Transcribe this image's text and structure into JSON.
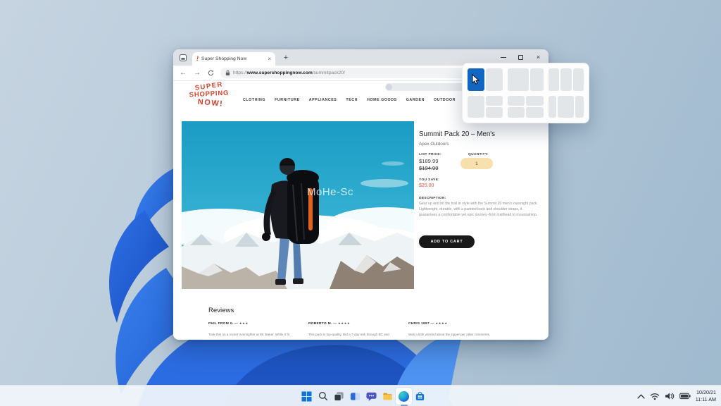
{
  "window": {
    "tab_title": "Super Shopping Now",
    "favicon_glyph": "!",
    "new_tab_glyph": "+",
    "tab_close_glyph": "×",
    "close_glyph": "×"
  },
  "toolbar": {
    "back_glyph": "←",
    "forward_glyph": "→",
    "url_prefix": "https://",
    "url_domain": "www.supershoppingnow.com",
    "url_path": "/summitpack20/"
  },
  "site": {
    "logo_lines": [
      "SUPER",
      "SHOPPING",
      "NOW!"
    ],
    "nav": [
      "CLOTHING",
      "FURNITURE",
      "APPLIANCES",
      "TECH",
      "HOME GOODS",
      "GARDEN",
      "OUTDOOR"
    ]
  },
  "product": {
    "title": "Summit Pack 20 – Men's",
    "brand": "Apex Outdoors",
    "list_price_label": "LIST PRICE:",
    "price": "$189.99",
    "old_price": "$194.99",
    "quantity_label": "QUANTITY:",
    "quantity_value": "1",
    "save_label": "YOU SAVE:",
    "save_value": "$25.00",
    "description_label": "DESCRIPTION:",
    "description": "Gear up and hit the trail in style with the Summit 20 men's overnight pack. Lightweight, durable, with a padded back and shoulder straps, it guarantees a comfortable yet epic journey–from trailhead to mountaintop.",
    "add_to_cart_label": "ADD TO CART"
  },
  "reviews": {
    "heading": "Reviews",
    "separator": "—",
    "items": [
      {
        "name": "PHIL FROM IL",
        "stars": "★★★",
        "text": "Took this on a recent overnighter at Mt. Baker. While it fit"
      },
      {
        "name": "ROBERTO M.",
        "stars": "★★★★",
        "text": "This pack is top-quality. Did a 7-day trek through BC and"
      },
      {
        "name": "CHRIS 1997",
        "stars": "★★★★",
        "text": "Was a little worried about the zipper per other comments,"
      }
    ]
  },
  "watermark": "MoHe-Sc",
  "snap_flyout": {
    "layouts": [
      "two-columns",
      "wide-left-narrow-right",
      "three-columns",
      "half-left-stacked-right",
      "quad-grid",
      "narrow-wide-narrow"
    ],
    "selected_cell": "layout-1-left-half"
  },
  "taskbar": {
    "icons": [
      "start",
      "search",
      "task-view",
      "widgets",
      "chat",
      "file-explorer",
      "edge",
      "store"
    ],
    "active_icon": "edge"
  },
  "tray": {
    "date": "10/20/21",
    "time": "11:11 AM"
  },
  "colors": {
    "snap_selection_blue": "#1166c2",
    "logo_red": "#d8402a",
    "sale_red": "#e25549",
    "quantity_pill": "#f8dfae",
    "add_to_cart_black": "#191919",
    "image_sky_teal": "#1f9fc6",
    "wallpaper_petal_blue": "#2c6ce2"
  }
}
